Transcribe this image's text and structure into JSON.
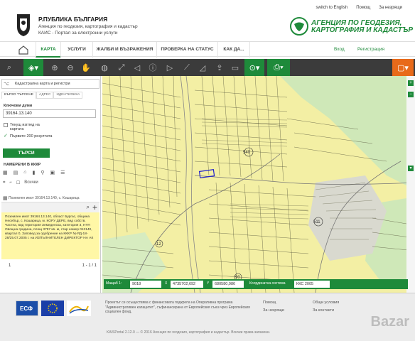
{
  "header": {
    "title_line1": "Р.ПУБЛИКА БЪЛГАРИЯ",
    "title_line2": "Агенция по геодезия, картография и кадастър",
    "title_line3": "КАИС - Портал за електронни услуги",
    "top_links": [
      "switch to English",
      "Помощ",
      "За незрящи"
    ],
    "agency_line1": "АГЕНЦИЯ ПО ГЕОДЕЗИЯ,",
    "agency_line2": "КАРТОГРАФИЯ И КАДАСТЪР"
  },
  "nav": {
    "items": [
      "КАРТА",
      "УСЛУГИ",
      "ЖАЛБИ И ВЪЗРАЖЕНИЯ",
      "ПРОВЕРКА НА СТАТУС",
      "КАК ДА..."
    ],
    "active_index": 0,
    "login": "Вход",
    "register": "Регистрация"
  },
  "toolbar": {
    "icons": [
      "search-icon",
      "layers-icon",
      "zoom-in-icon",
      "zoom-out-icon",
      "pan-icon",
      "globe-icon",
      "extent-icon",
      "back-icon",
      "forward-icon",
      "info-icon",
      "measure-icon",
      "area-icon",
      "export-icon",
      "print-area-icon",
      "location-icon",
      "print-icon",
      "fullscreen-icon"
    ]
  },
  "left_panel": {
    "layer_select": "Кадастрална карта и регистри",
    "tabs": [
      "БЪРЗО ТЪРСЕНЕ",
      "АДРЕС",
      "ИДЕНТИФИКА"
    ],
    "keywords_label": "Ключови думи",
    "keywords_value": "39164.13.140",
    "check_current_area": "Текущ изглед на картата",
    "check_first_200": "Първите 200 резултата",
    "search_button": "ТЪРСИ",
    "found_label": "НАМЕРЕНИ В КККР",
    "all_label": "Всички",
    "result_header": "Поземлен имот 39164.13.140, с. Кошарица",
    "result_text": "Поземлен имот 39164.13.140, област Бургас, община Несебър, с. Кошарица, м. КОРУ ДЕРЕ, вид собств. Частна, вид територия Земеделска, категория 3, НТП Овощна градина, площ 3757 кв. м, стар номер 013140, квартал 0, Заповед за одобрение на КККР № РД-18-28/25.07.2005 г. на ИЗПЪЛНИТЕЛЕН ДИРЕКТОР НА АК",
    "pager_current": "1",
    "pager_count": "1 - 1 / 1"
  },
  "coord_bar": {
    "scale_label": "Мащаб 1:",
    "scale_value": "9018",
    "x_label": "X",
    "x_value": "4735702,692",
    "y_label": "Y",
    "y_value": "680580,986",
    "system_label": "Координатна система",
    "system_value": "ККС 2005"
  },
  "map": {
    "labels": [
      "540",
      "511",
      "12",
      "90"
    ]
  },
  "footer": {
    "text": "Проектът се осъществява с финансовата подкрепа на Оперативна програма \"Административен капацитет\", съфинансирана от Европейския съюз чрез Европейския социален фонд.",
    "links1": [
      "Помощ",
      "За незрящи"
    ],
    "links2": [
      "Общи условия",
      "За контакти"
    ],
    "copyright": "KAISPortal 2.12.0 — © 2016 Агенция по геодезия, картография и кадастър. Всички права запазени.",
    "watermark": "Bazar"
  },
  "colors": {
    "brand_green": "#1e8a3a",
    "toolbar_dark": "#3b3b3b",
    "map_bg": "#f3efa4",
    "result_bg": "#fff7a6",
    "accent_orange": "#e86a1a"
  }
}
